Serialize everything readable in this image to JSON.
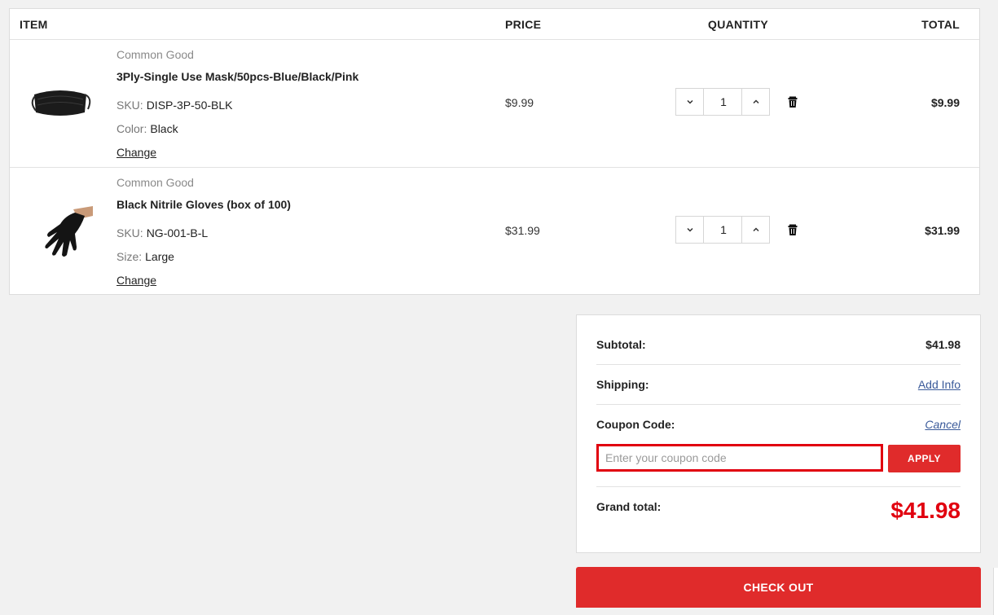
{
  "table": {
    "headers": {
      "item": "ITEM",
      "price": "PRICE",
      "quantity": "QUANTITY",
      "total": "TOTAL"
    },
    "items": [
      {
        "brand": "Common Good",
        "name": "3Ply-Single Use Mask/50pcs-Blue/Black/Pink",
        "sku_label": "SKU:",
        "sku": "DISP-3P-50-BLK",
        "attr_label": "Color:",
        "attr_value": "Black",
        "change_label": "Change",
        "price": "$9.99",
        "quantity": "1",
        "total": "$9.99",
        "thumbnail": "face-mask-image"
      },
      {
        "brand": "Common Good",
        "name": "Black Nitrile Gloves (box of 100)",
        "sku_label": "SKU:",
        "sku": "NG-001-B-L",
        "attr_label": "Size:",
        "attr_value": "Large",
        "change_label": "Change",
        "price": "$31.99",
        "quantity": "1",
        "total": "$31.99",
        "thumbnail": "nitrile-glove-image"
      }
    ]
  },
  "summary": {
    "subtotal_label": "Subtotal:",
    "subtotal_value": "$41.98",
    "shipping_label": "Shipping:",
    "shipping_link": "Add Info",
    "coupon_label": "Coupon Code:",
    "coupon_cancel": "Cancel",
    "coupon_placeholder": "Enter your coupon code",
    "apply_label": "APPLY",
    "grand_total_label": "Grand total:",
    "grand_total_value": "$41.98"
  },
  "checkout_label": "CHECK OUT",
  "colors": {
    "accent_red": "#e02b2b",
    "grand_total_red": "#e1000f",
    "link_blue": "#3a5a9a"
  },
  "icons": {
    "decrease": "chevron-down-icon",
    "increase": "chevron-up-icon",
    "remove": "trash-icon"
  }
}
